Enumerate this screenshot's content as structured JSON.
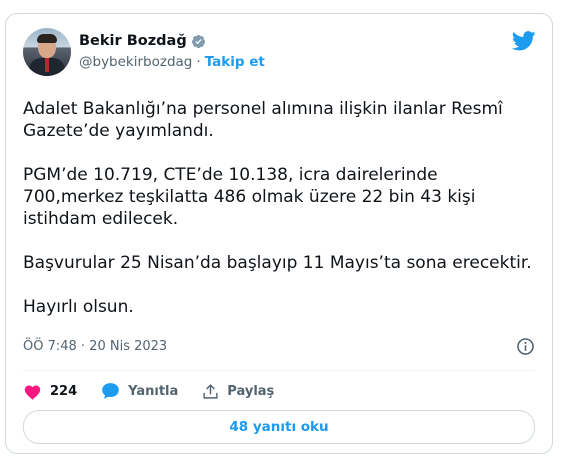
{
  "author": {
    "name": "Bekir Bozdağ",
    "handle": "@bybekirbozdag",
    "separator": "·",
    "follow_label": "Takip et",
    "verified": true
  },
  "tweet": {
    "text": "Adalet Bakanlığı’na personel alımına ilişkin ilanlar Resmî Gazete’de yayımlandı.\n\nPGM’de 10.719, CTE’de 10.138, icra dairelerinde 700,merkez teşkilatta 486 olmak üzere 22 bin 43 kişi istihdam edilecek.\n\nBaşvurular 25 Nisan’da başlayıp 11 Mayıs’ta sona erecektir.\n\nHayırlı olsun.",
    "timestamp": "ÖÖ 7:48 · 20 Nis 2023"
  },
  "actions": {
    "like_count": "224",
    "reply_label": "Yanıtla",
    "share_label": "Paylaş"
  },
  "read_replies_label": "48 yanıtı oku",
  "colors": {
    "accent": "#1d9bf0",
    "like": "#f91880",
    "muted": "#536471",
    "border": "#cfd9de"
  },
  "icons": [
    "verified-badge-icon",
    "twitter-logo-icon",
    "info-icon",
    "heart-icon",
    "reply-bubble-icon",
    "share-icon"
  ]
}
